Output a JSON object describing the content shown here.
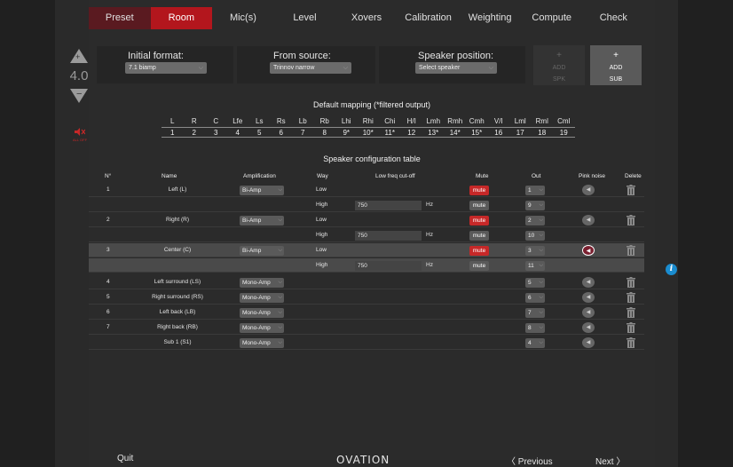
{
  "tabs": [
    "Preset",
    "Room",
    "Mic(s)",
    "Level",
    "Xovers",
    "Calibration",
    "Weighting",
    "Compute",
    "Check"
  ],
  "active_tab": "Room",
  "zoom": "4.0",
  "zoom_plus": "+",
  "zoom_minus": "−",
  "mute_indicator": "ALL OFF",
  "initial_format": {
    "label": "Initial format:",
    "value": "7.1 biamp"
  },
  "from_source": {
    "label": "From source:",
    "value": "Trinnov narrow"
  },
  "speaker_position": {
    "label": "Speaker position:",
    "value": "Select speaker"
  },
  "add_spk": {
    "plus": "+",
    "l1": "ADD",
    "l2": "SPK"
  },
  "add_sub": {
    "plus": "+",
    "l1": "ADD",
    "l2": "SUB"
  },
  "mapping_title": "Default mapping (*filtered output)",
  "mapping_channels": [
    "L",
    "R",
    "C",
    "Lfe",
    "Ls",
    "Rs",
    "Lb",
    "Rb",
    "Lhi",
    "Rhi",
    "Chi",
    "H/I",
    "Lmh",
    "Rmh",
    "Cmh",
    "V/I",
    "Lml",
    "Rml",
    "Cml"
  ],
  "mapping_outputs": [
    "1",
    "2",
    "3",
    "4",
    "5",
    "6",
    "7",
    "8",
    "9*",
    "10*",
    "11*",
    "12",
    "13*",
    "14*",
    "15*",
    "16",
    "17",
    "18",
    "19"
  ],
  "table_title": "Speaker configuration table",
  "headers": {
    "n": "N°",
    "name": "Name",
    "amp": "Amplification",
    "way": "Way",
    "freq": "Low freq cut-off",
    "mute": "Mute",
    "out": "Out",
    "pink": "Pink noise",
    "delete": "Delete"
  },
  "rows": [
    {
      "n": "1",
      "name": "Left (L)",
      "amp": "Bi-Amp",
      "way": "Low",
      "freq": "",
      "unit": "",
      "mute": "mute",
      "out": "1"
    },
    {
      "n": "",
      "name": "",
      "amp": "",
      "way": "High",
      "freq": "750",
      "unit": "Hz",
      "mute": "mute",
      "out": "9"
    },
    {
      "n": "2",
      "name": "Right (R)",
      "amp": "Bi-Amp",
      "way": "Low",
      "freq": "",
      "unit": "",
      "mute": "mute",
      "out": "2"
    },
    {
      "n": "",
      "name": "",
      "amp": "",
      "way": "High",
      "freq": "750",
      "unit": "Hz",
      "mute": "mute",
      "out": "10"
    },
    {
      "n": "3",
      "name": "Center (C)",
      "amp": "Bi-Amp",
      "way": "Low",
      "freq": "",
      "unit": "",
      "mute": "mute",
      "out": "3"
    },
    {
      "n": "",
      "name": "",
      "amp": "",
      "way": "High",
      "freq": "750",
      "unit": "Hz",
      "mute": "mute",
      "out": "11"
    },
    {
      "n": "4",
      "name": "Left surround (LS)",
      "amp": "Mono-Amp",
      "way": "",
      "freq": "",
      "unit": "",
      "mute": "",
      "out": "5"
    },
    {
      "n": "5",
      "name": "Right surround (RS)",
      "amp": "Mono-Amp",
      "way": "",
      "freq": "",
      "unit": "",
      "mute": "",
      "out": "6"
    },
    {
      "n": "6",
      "name": "Left back (LB)",
      "amp": "Mono-Amp",
      "way": "",
      "freq": "",
      "unit": "",
      "mute": "",
      "out": "7"
    },
    {
      "n": "7",
      "name": "Right back (RB)",
      "amp": "Mono-Amp",
      "way": "",
      "freq": "",
      "unit": "",
      "mute": "",
      "out": "8"
    },
    {
      "n": "",
      "name": "Sub 1 (S1)",
      "amp": "Mono-Amp",
      "way": "",
      "freq": "",
      "unit": "",
      "mute": "",
      "out": "4"
    }
  ],
  "footer": {
    "quit": "Quit",
    "logo": "OVATION",
    "previous": "〈  Previous",
    "next": "Next  〉"
  },
  "info": "i",
  "colors": {
    "accent": "#b3161d",
    "preset_tab": "#5a1a20",
    "info": "#1a8ccf"
  }
}
